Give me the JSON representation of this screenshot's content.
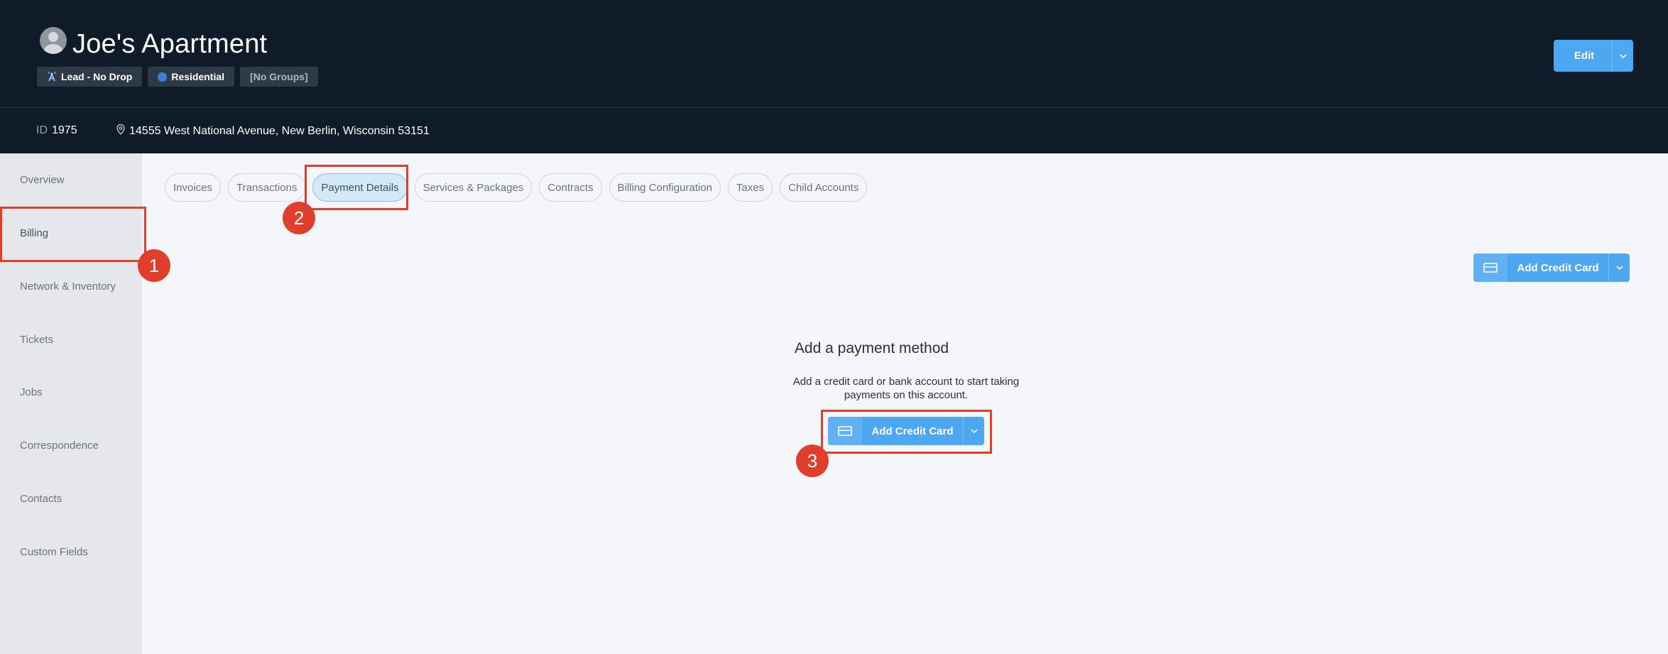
{
  "header": {
    "title": "Joe's Apartment",
    "badges": [
      "Lead - No Drop",
      "Residential",
      "[No Groups]"
    ],
    "edit_label": "Edit"
  },
  "subheader": {
    "id_label": "ID",
    "id_value": "1975",
    "address": "14555 West National Avenue, New Berlin, Wisconsin 53151"
  },
  "sidebar": {
    "items": [
      {
        "label": "Overview"
      },
      {
        "label": "Billing"
      },
      {
        "label": "Network & Inventory"
      },
      {
        "label": "Tickets"
      },
      {
        "label": "Jobs"
      },
      {
        "label": "Correspondence"
      },
      {
        "label": "Contacts"
      },
      {
        "label": "Custom Fields"
      }
    ],
    "active": "Billing"
  },
  "tabs": {
    "items": [
      {
        "label": "Invoices"
      },
      {
        "label": "Transactions"
      },
      {
        "label": "Payment Details"
      },
      {
        "label": "Services & Packages"
      },
      {
        "label": "Contracts"
      },
      {
        "label": "Billing Configuration"
      },
      {
        "label": "Taxes"
      },
      {
        "label": "Child Accounts"
      }
    ],
    "active": "Payment Details"
  },
  "main": {
    "top_button_label": "Add Credit Card",
    "empty_title": "Add a payment method",
    "empty_description": "Add a credit card or bank account to start taking payments on this account.",
    "center_button_label": "Add Credit Card"
  },
  "annotations": [
    "1",
    "2",
    "3"
  ],
  "colors": {
    "header_bg": "#0f1b29",
    "accent": "#4ea8f1",
    "annotation": "#e03f2c",
    "sidebar_bg": "#e5e7ea"
  },
  "icons": [
    "user-avatar-icon",
    "lead-tower-icon",
    "residential-dot-icon",
    "map-pin-icon",
    "chevron-down-icon",
    "credit-card-icon"
  ]
}
